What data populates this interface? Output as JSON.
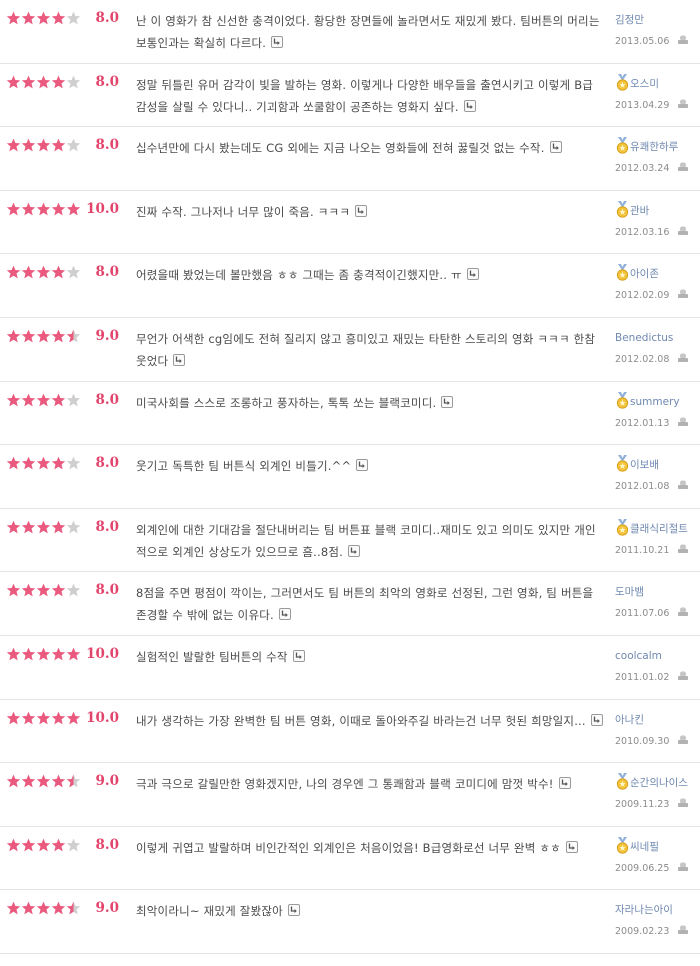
{
  "accent_color": "#e2456c",
  "star_filled_color": "#ea5a7f",
  "star_empty_color": "#cfcfcf",
  "user_link_color": "#6f89b0",
  "icons": {
    "more": "reply-arrow-icon",
    "medal": "medal-icon",
    "report": "report-icon"
  },
  "reviews": [
    {
      "rating": 4,
      "score": "8.0",
      "comment": "난 이 영화가 참 신선한 충격이었다. 황당한 장면들에 놀라면서도 재밌게 봤다. 팀버튼의 머리는 보통인과는 확실히 다르다.",
      "user": "김정만",
      "date": "2013.05.06",
      "medal": false
    },
    {
      "rating": 4,
      "score": "8.0",
      "comment": "정말 뒤틀린 유머 감각이 빛을 발하는 영화. 이렇게나 다양한 배우들을 출연시키고 이렇게 B급 감성을 살릴 수 있다니.. 기괴함과 쏘쿨함이 공존하는 영화지 싶다.",
      "user": "오스미",
      "date": "2013.04.29",
      "medal": true
    },
    {
      "rating": 4,
      "score": "8.0",
      "comment": "십수년만에 다시 봤는데도 CG 외에는 지금 나오는 영화들에 전혀 꿇릴것 없는 수작.",
      "user": "유쾌한하루",
      "date": "2012.03.24",
      "medal": true
    },
    {
      "rating": 5,
      "score": "10.0",
      "comment": "진짜 수작. 그나저나 너무 많이 죽음. ㅋㅋㅋ",
      "user": "관바",
      "date": "2012.03.16",
      "medal": true
    },
    {
      "rating": 4,
      "score": "8.0",
      "comment": "어렸을때 봤었는데 볼만했음 ㅎㅎ 그때는 좀 충격적이긴했지만.. ㅠ",
      "user": "아이존",
      "date": "2012.02.09",
      "medal": true
    },
    {
      "rating": 4.5,
      "score": "9.0",
      "comment": "무언가 어색한 cg임에도 전혀 질리지 않고 흥미있고 재밌는 타탄한 스토리의 영화 ㅋㅋㅋ 한참 웃었다",
      "user": "Benedictus",
      "date": "2012.02.08",
      "medal": false
    },
    {
      "rating": 4,
      "score": "8.0",
      "comment": "미국사회를 스스로 조롱하고 풍자하는, 톡톡 쏘는 블랙코미디.",
      "user": "summery",
      "date": "2012.01.13",
      "medal": true
    },
    {
      "rating": 4,
      "score": "8.0",
      "comment": "웃기고 독특한 팀 버튼식 외계인 비틀기.^^",
      "user": "이보배",
      "date": "2012.01.08",
      "medal": true
    },
    {
      "rating": 4,
      "score": "8.0",
      "comment": "외계인에 대한 기대감을 절단내버리는 팀 버튼표 블랙 코미디..재미도 있고 의미도 있지만 개인적으로 외계인 상상도가 있으므로 흠..8점.",
      "user": "클래식리절트",
      "date": "2011.10.21",
      "medal": true
    },
    {
      "rating": 4,
      "score": "8.0",
      "comment": "8점을 주면 평점이 깍이는, 그러면서도 팀 버튼의 최악의 영화로 선정된, 그런 영화, 팀 버튼을 존경할 수 밖에 없는 이유다.",
      "user": "도마뱀",
      "date": "2011.07.06",
      "medal": false
    },
    {
      "rating": 5,
      "score": "10.0",
      "comment": "실험적인 발랄한 팀버튼의 수작",
      "user": "coolcalm",
      "date": "2011.01.02",
      "medal": false
    },
    {
      "rating": 5,
      "score": "10.0",
      "comment": "내가 생각하는 가장 완벽한 팀 버튼 영화, 이때로 돌아와주길 바라는건 너무 헛된 희망일지...",
      "user": "아나킨",
      "date": "2010.09.30",
      "medal": false
    },
    {
      "rating": 4.5,
      "score": "9.0",
      "comment": "극과 극으로 갈릴만한 영화겠지만, 나의 경우엔 그 통쾌함과 블랙 코미디에 맘껏 박수!",
      "user": "순간의나이스",
      "date": "2009.11.23",
      "medal": true
    },
    {
      "rating": 4,
      "score": "8.0",
      "comment": "이렇게 귀엽고 발랄하며 비인간적인 외계인은 처음이었음! B급영화로선 너무 완벽 ㅎㅎ",
      "user": "씨네필",
      "date": "2009.06.25",
      "medal": true
    },
    {
      "rating": 4.5,
      "score": "9.0",
      "comment": "최악이라니~ 재밌게 잘봤잖아",
      "user": "자라나는아이",
      "date": "2009.02.23",
      "medal": false
    }
  ]
}
